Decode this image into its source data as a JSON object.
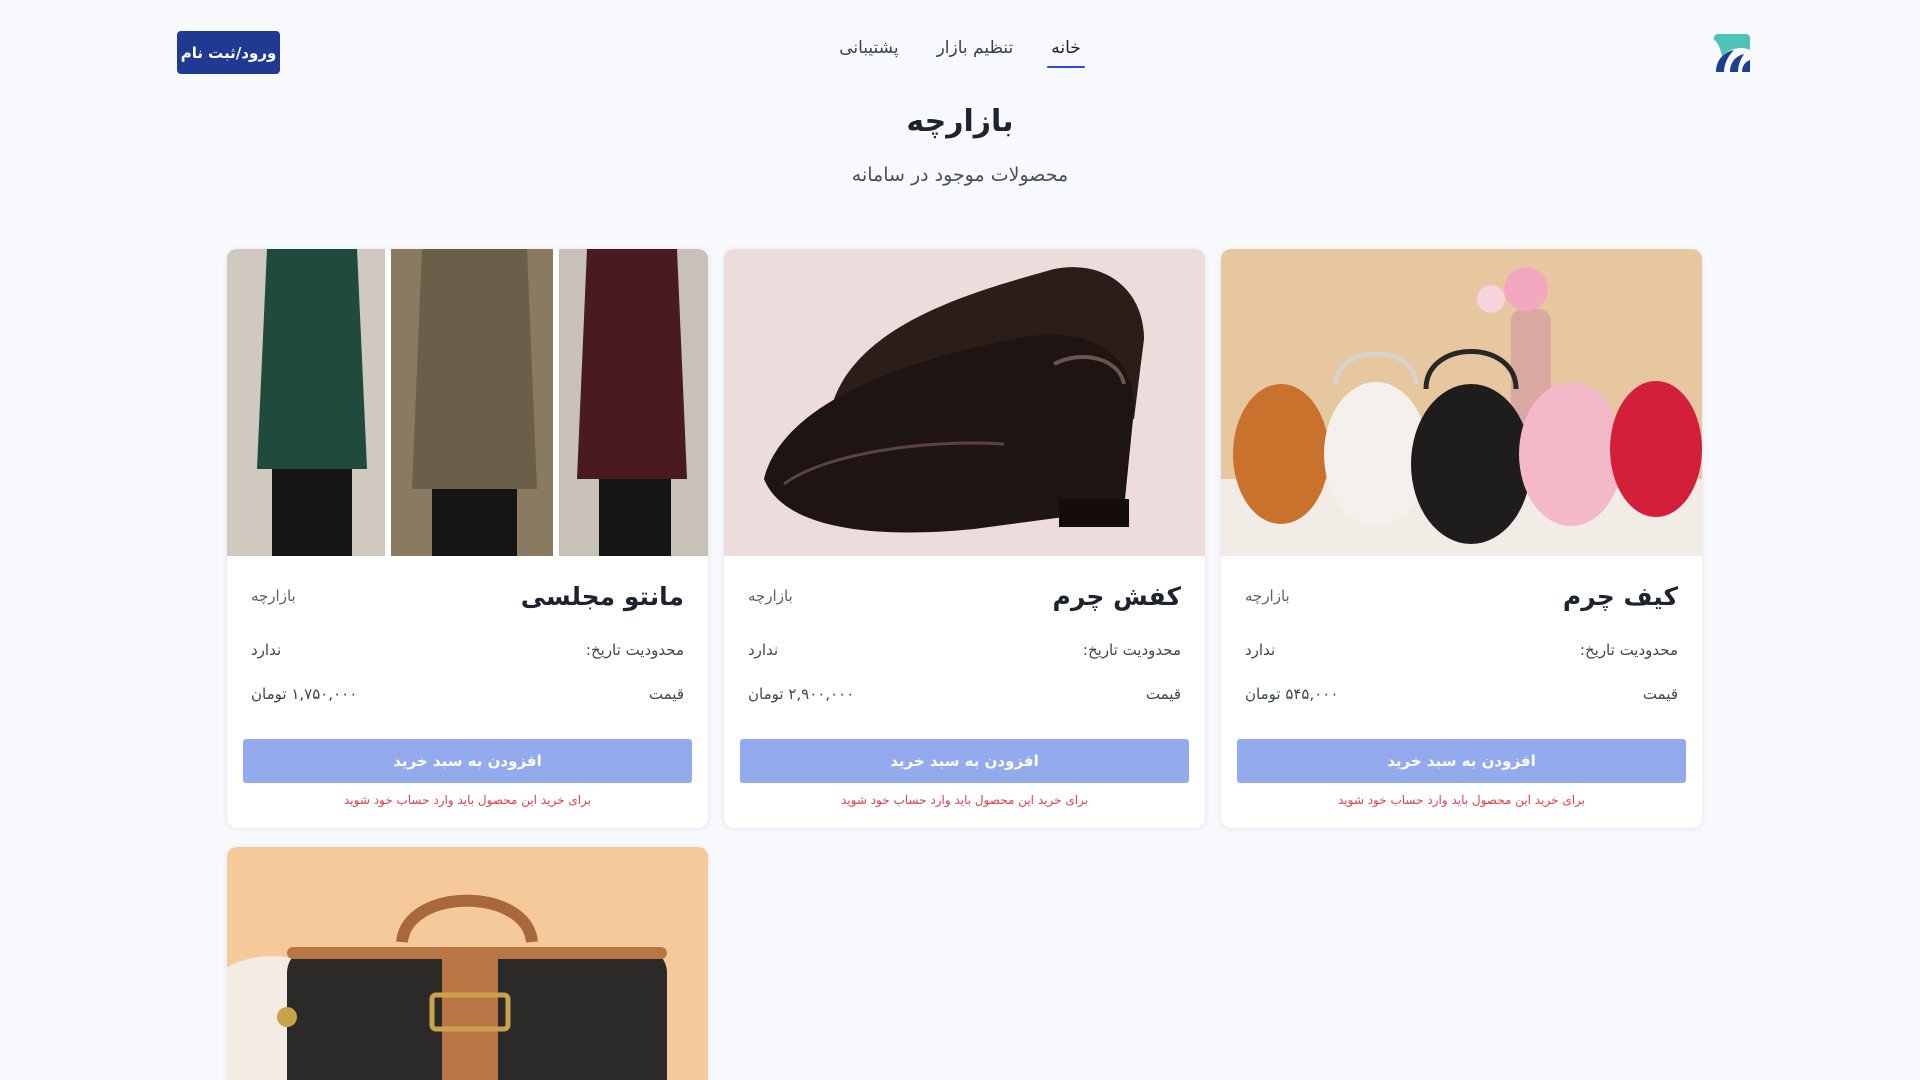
{
  "header": {
    "nav": [
      "خانه",
      "تنظیم بازار",
      "پشتیبانی"
    ],
    "login_label": "ورود/ثبت نام"
  },
  "page": {
    "title": "بازارچه",
    "subtitle": "محصولات موجود در سامانه"
  },
  "products": [
    {
      "name": "کیف چرم",
      "shop": "بازارچه",
      "date_label": "محدودیت تاریخ:",
      "date_value": "ندارد",
      "price_label": "قیمت",
      "price_value": "۵۴۵,۰۰۰ تومان",
      "button": "افزودن به سبد خرید",
      "warning": "برای خرید این محصول باید وارد حساب خود شوید",
      "image": "handbags-photo"
    },
    {
      "name": "کفش چرم",
      "shop": "بازارچه",
      "date_label": "محدودیت تاریخ:",
      "date_value": "ندارد",
      "price_label": "قیمت",
      "price_value": "۲,۹۰۰,۰۰۰ تومان",
      "button": "افزودن به سبد خرید",
      "warning": "برای خرید این محصول باید وارد حساب خود شوید",
      "image": "leather-shoes-photo"
    },
    {
      "name": "مانتو مجلسی",
      "shop": "بازارچه",
      "date_label": "محدودیت تاریخ:",
      "date_value": "ندارد",
      "price_label": "قیمت",
      "price_value": "۱,۷۵۰,۰۰۰ تومان",
      "button": "افزودن به سبد خرید",
      "warning": "برای خرید این محصول باید وارد حساب خود شوید",
      "image": "coats-photo"
    },
    {
      "image": "leather-bag-photo"
    }
  ],
  "colors": {
    "primary": "#203a91",
    "button": "#93aaec",
    "warning": "#e0404a",
    "background": "#f7f9fd"
  }
}
